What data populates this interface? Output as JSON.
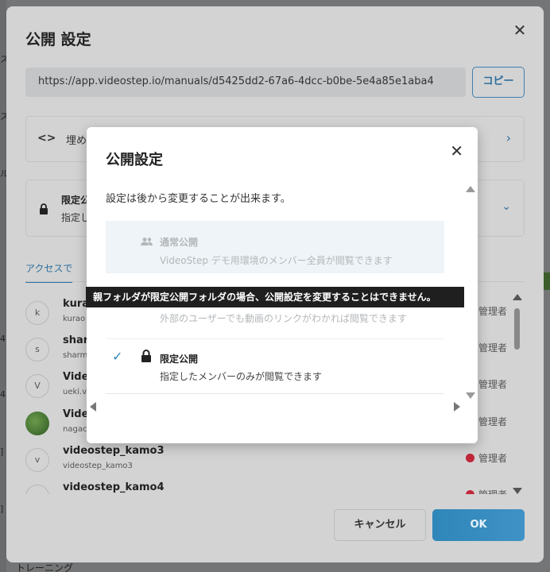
{
  "background": {
    "left_fragments": [
      "ス",
      "ス",
      "ル",
      "4",
      "4",
      "]",
      "]"
    ],
    "bottom_text": "トレーニング"
  },
  "outer_dialog": {
    "title": "公開 設定",
    "close_icon": "close-icon",
    "share_url": "https://app.videostep.io/manuals/d5425dd2-67a6-4dcc-b0be-5e4a85e1aba4",
    "copy_label": "コピー",
    "embed": {
      "icon": "<>",
      "label": "埋め"
    },
    "visibility": {
      "title": "限定公",
      "desc": "指定し"
    },
    "access_tab": "アクセスで",
    "members": [
      {
        "avatar": "k",
        "name": "kura",
        "sub": "kurao",
        "role": "管理者"
      },
      {
        "avatar": "s",
        "name": "sharr",
        "sub": "sharm",
        "role": "管理者"
      },
      {
        "avatar": "V",
        "name": "Video",
        "sub": "ueki.v",
        "role": "管理者"
      },
      {
        "avatar": "",
        "name": "Vide",
        "sub": "nagac",
        "role": "管理者"
      },
      {
        "avatar": "v",
        "name": "videostep_kamo3",
        "sub": "videostep_kamo3",
        "role": "管理者"
      },
      {
        "avatar": "v",
        "name": "videostep_kamo4",
        "sub": "",
        "role": "管理者"
      }
    ],
    "cancel_label": "キャンセル",
    "ok_label": "OK",
    "colors": {
      "accent": "#2f86b8",
      "role_dot": "#c0283a"
    }
  },
  "modal": {
    "title": "公開設定",
    "description": "設定は後から変更することが出来ます。",
    "options": {
      "public": {
        "title": "通常公開",
        "desc": "VideoStep デモ用環境のメンバー全員が閲覧できます",
        "icon": "users-icon"
      },
      "link": {
        "desc": "外部のユーザーでも動画のリンクがわかれば閲覧できます"
      },
      "limited": {
        "title": "限定公開",
        "desc": "指定したメンバーのみが閲覧できます",
        "icon": "lock-icon",
        "selected": true
      }
    },
    "tooltip": "親フォルダが限定公開フォルダの場合、公開設定を変更することはできません。"
  }
}
